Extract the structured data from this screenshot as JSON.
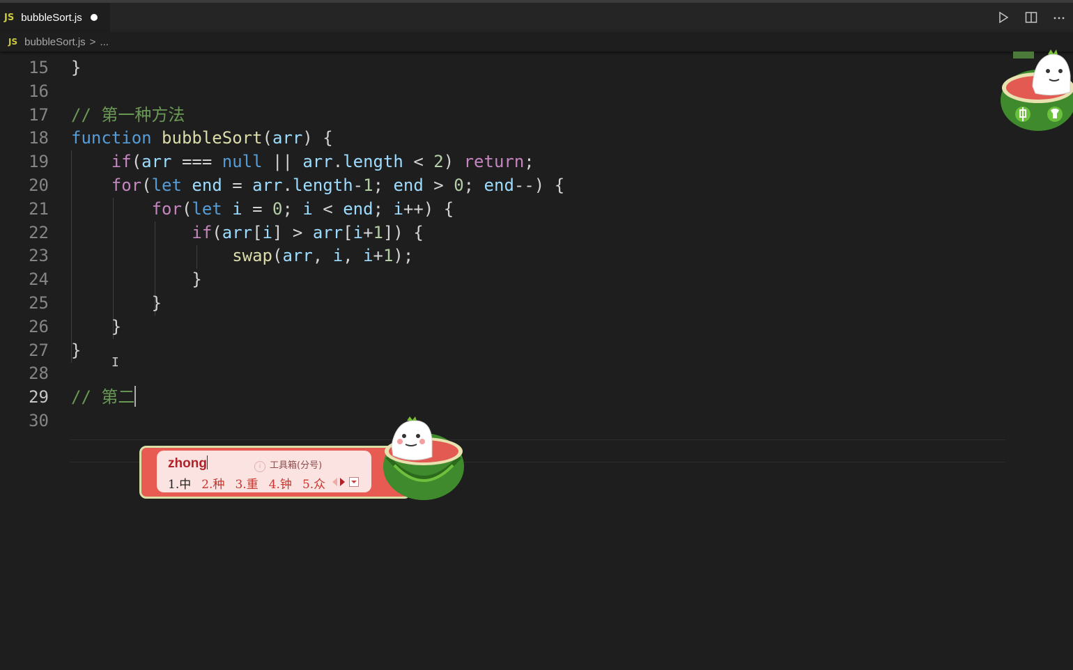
{
  "tab": {
    "badge": "JS",
    "title": "bubbleSort.js"
  },
  "breadcrumb": {
    "badge": "JS",
    "file": "bubbleSort.js",
    "sep": ">",
    "rest": "..."
  },
  "editor": {
    "lines": [
      {
        "n": "15",
        "tokens": [
          {
            "t": "}",
            "c": "op"
          }
        ]
      },
      {
        "n": "16",
        "tokens": []
      },
      {
        "n": "17",
        "tokens": [
          {
            "t": "// 第一种方法",
            "c": "cmt"
          }
        ]
      },
      {
        "n": "18",
        "tokens": [
          {
            "t": "function",
            "c": "kw"
          },
          {
            "t": " ",
            "c": "op"
          },
          {
            "t": "bubbleSort",
            "c": "fn"
          },
          {
            "t": "(",
            "c": "op"
          },
          {
            "t": "arr",
            "c": "var"
          },
          {
            "t": ") {",
            "c": "op"
          }
        ]
      },
      {
        "n": "19",
        "tokens": [
          {
            "t": "    ",
            "c": "op"
          },
          {
            "t": "if",
            "c": "ctl"
          },
          {
            "t": "(",
            "c": "op"
          },
          {
            "t": "arr",
            "c": "var"
          },
          {
            "t": " === ",
            "c": "op"
          },
          {
            "t": "null",
            "c": "kw"
          },
          {
            "t": " || ",
            "c": "op"
          },
          {
            "t": "arr",
            "c": "var"
          },
          {
            "t": ".",
            "c": "op"
          },
          {
            "t": "length",
            "c": "var"
          },
          {
            "t": " < ",
            "c": "op"
          },
          {
            "t": "2",
            "c": "num"
          },
          {
            "t": ") ",
            "c": "op"
          },
          {
            "t": "return",
            "c": "ctl"
          },
          {
            "t": ";",
            "c": "op"
          }
        ]
      },
      {
        "n": "20",
        "tokens": [
          {
            "t": "    ",
            "c": "op"
          },
          {
            "t": "for",
            "c": "ctl"
          },
          {
            "t": "(",
            "c": "op"
          },
          {
            "t": "let",
            "c": "kw"
          },
          {
            "t": " ",
            "c": "op"
          },
          {
            "t": "end",
            "c": "var"
          },
          {
            "t": " = ",
            "c": "op"
          },
          {
            "t": "arr",
            "c": "var"
          },
          {
            "t": ".",
            "c": "op"
          },
          {
            "t": "length",
            "c": "var"
          },
          {
            "t": "-",
            "c": "op"
          },
          {
            "t": "1",
            "c": "num"
          },
          {
            "t": "; ",
            "c": "op"
          },
          {
            "t": "end",
            "c": "var"
          },
          {
            "t": " > ",
            "c": "op"
          },
          {
            "t": "0",
            "c": "num"
          },
          {
            "t": "; ",
            "c": "op"
          },
          {
            "t": "end",
            "c": "var"
          },
          {
            "t": "--) {",
            "c": "op"
          }
        ]
      },
      {
        "n": "21",
        "tokens": [
          {
            "t": "        ",
            "c": "op"
          },
          {
            "t": "for",
            "c": "ctl"
          },
          {
            "t": "(",
            "c": "op"
          },
          {
            "t": "let",
            "c": "kw"
          },
          {
            "t": " ",
            "c": "op"
          },
          {
            "t": "i",
            "c": "var"
          },
          {
            "t": " = ",
            "c": "op"
          },
          {
            "t": "0",
            "c": "num"
          },
          {
            "t": "; ",
            "c": "op"
          },
          {
            "t": "i",
            "c": "var"
          },
          {
            "t": " < ",
            "c": "op"
          },
          {
            "t": "end",
            "c": "var"
          },
          {
            "t": "; ",
            "c": "op"
          },
          {
            "t": "i",
            "c": "var"
          },
          {
            "t": "++) {",
            "c": "op"
          }
        ]
      },
      {
        "n": "22",
        "tokens": [
          {
            "t": "            ",
            "c": "op"
          },
          {
            "t": "if",
            "c": "ctl"
          },
          {
            "t": "(",
            "c": "op"
          },
          {
            "t": "arr",
            "c": "var"
          },
          {
            "t": "[",
            "c": "op"
          },
          {
            "t": "i",
            "c": "var"
          },
          {
            "t": "] > ",
            "c": "op"
          },
          {
            "t": "arr",
            "c": "var"
          },
          {
            "t": "[",
            "c": "op"
          },
          {
            "t": "i",
            "c": "var"
          },
          {
            "t": "+",
            "c": "op"
          },
          {
            "t": "1",
            "c": "num"
          },
          {
            "t": "]) {",
            "c": "op"
          }
        ]
      },
      {
        "n": "23",
        "tokens": [
          {
            "t": "                ",
            "c": "op"
          },
          {
            "t": "swap",
            "c": "fn"
          },
          {
            "t": "(",
            "c": "op"
          },
          {
            "t": "arr",
            "c": "var"
          },
          {
            "t": ", ",
            "c": "op"
          },
          {
            "t": "i",
            "c": "var"
          },
          {
            "t": ", ",
            "c": "op"
          },
          {
            "t": "i",
            "c": "var"
          },
          {
            "t": "+",
            "c": "op"
          },
          {
            "t": "1",
            "c": "num"
          },
          {
            "t": ");",
            "c": "op"
          }
        ]
      },
      {
        "n": "24",
        "tokens": [
          {
            "t": "            }",
            "c": "op"
          }
        ]
      },
      {
        "n": "25",
        "tokens": [
          {
            "t": "        }",
            "c": "op"
          }
        ]
      },
      {
        "n": "26",
        "tokens": [
          {
            "t": "    }",
            "c": "op"
          }
        ]
      },
      {
        "n": "27",
        "tokens": [
          {
            "t": "}",
            "c": "op"
          }
        ]
      },
      {
        "n": "28",
        "tokens": []
      },
      {
        "n": "29",
        "tokens": [
          {
            "t": "// 第二",
            "c": "cmt"
          }
        ],
        "active": true
      },
      {
        "n": "30",
        "tokens": []
      }
    ]
  },
  "ime": {
    "pinyin": "zhong",
    "toolbox": "工具箱(分号)",
    "candidates": [
      "1.中",
      "2.种",
      "3.重",
      "4.钟",
      "5.众"
    ]
  },
  "colors": {
    "background": "#1e1e1e",
    "keyword": "#569cd6",
    "control": "#c586c0",
    "function": "#dcdcaa",
    "variable": "#9cdcfe",
    "number": "#b5cea8",
    "comment": "#6a9955"
  }
}
